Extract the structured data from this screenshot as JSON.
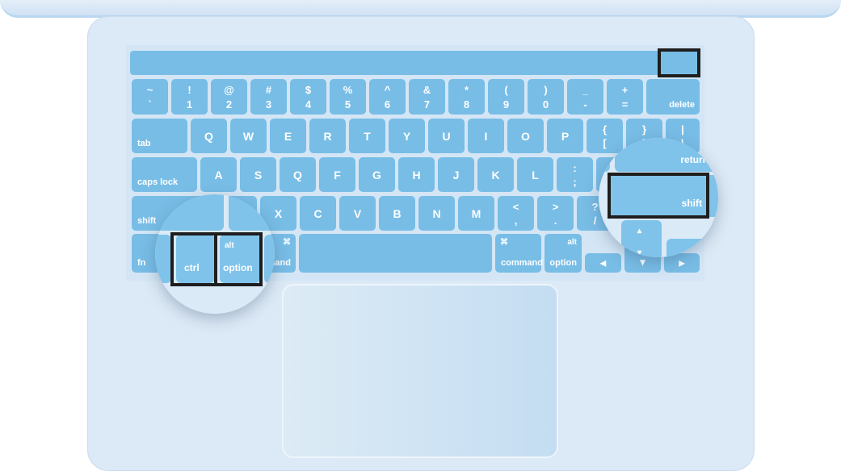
{
  "keyboard": {
    "rows": [
      [
        {
          "t": "~",
          "b": "`"
        },
        {
          "t": "!",
          "b": "1"
        },
        {
          "t": "@",
          "b": "2"
        },
        {
          "t": "#",
          "b": "3"
        },
        {
          "t": "$",
          "b": "4"
        },
        {
          "t": "%",
          "b": "5"
        },
        {
          "t": "^",
          "b": "6"
        },
        {
          "t": "&",
          "b": "7"
        },
        {
          "t": "*",
          "b": "8"
        },
        {
          "t": "(",
          "b": "9"
        },
        {
          "t": ")",
          "b": "0"
        },
        {
          "t": "_",
          "b": "-"
        },
        {
          "t": "+",
          "b": "="
        },
        {
          "br": "delete"
        }
      ],
      [
        {
          "bl": "tab"
        },
        {
          "c": "Q"
        },
        {
          "c": "W"
        },
        {
          "c": "E"
        },
        {
          "c": "R"
        },
        {
          "c": "T"
        },
        {
          "c": "Y"
        },
        {
          "c": "U"
        },
        {
          "c": "I"
        },
        {
          "c": "O"
        },
        {
          "c": "P"
        },
        {
          "t": "{",
          "b": "["
        },
        {
          "t": "}",
          "b": "]"
        },
        {
          "t": "|",
          "b": "\\"
        }
      ],
      [
        {
          "bl": "caps lock"
        },
        {
          "c": "A"
        },
        {
          "c": "S"
        },
        {
          "c": "Q"
        },
        {
          "c": "F"
        },
        {
          "c": "G"
        },
        {
          "c": "H"
        },
        {
          "c": "J"
        },
        {
          "c": "K"
        },
        {
          "c": "L"
        },
        {
          "t": ":",
          "b": ";"
        },
        {
          "t": "\"",
          "b": "'"
        },
        {
          "br": "return"
        }
      ],
      [
        {
          "bl": "shift"
        },
        {
          "c": "Z"
        },
        {
          "c": "X"
        },
        {
          "c": "C"
        },
        {
          "c": "V"
        },
        {
          "c": "B"
        },
        {
          "c": "N"
        },
        {
          "c": "M"
        },
        {
          "t": "<",
          "b": ","
        },
        {
          "t": ">",
          "b": "."
        },
        {
          "t": "?",
          "b": "/"
        },
        {
          "br": "shift"
        }
      ],
      [
        {
          "bl": "fn"
        },
        {
          "bl": "ctrl"
        },
        {
          "tl": "alt",
          "bl": "option"
        },
        {
          "tr": "⌘",
          "br": "command"
        },
        {
          "c": ""
        },
        {
          "tl": "⌘",
          "bl": "command"
        },
        {
          "tr": "alt",
          "br": "option"
        },
        {
          "c": "◂"
        },
        {
          "t": "▴",
          "b": "▾"
        },
        {
          "c": "▸"
        }
      ]
    ]
  },
  "magnifier_left": {
    "ctrl": "ctrl",
    "alt": "alt",
    "option": "option"
  },
  "magnifier_right": {
    "return": "return",
    "shift": "shift",
    "up": "▴",
    "down": "▾"
  },
  "colors": {
    "key": "#78bde6",
    "highlight_box": "#1e1e1e",
    "body": "#dce9f6"
  }
}
